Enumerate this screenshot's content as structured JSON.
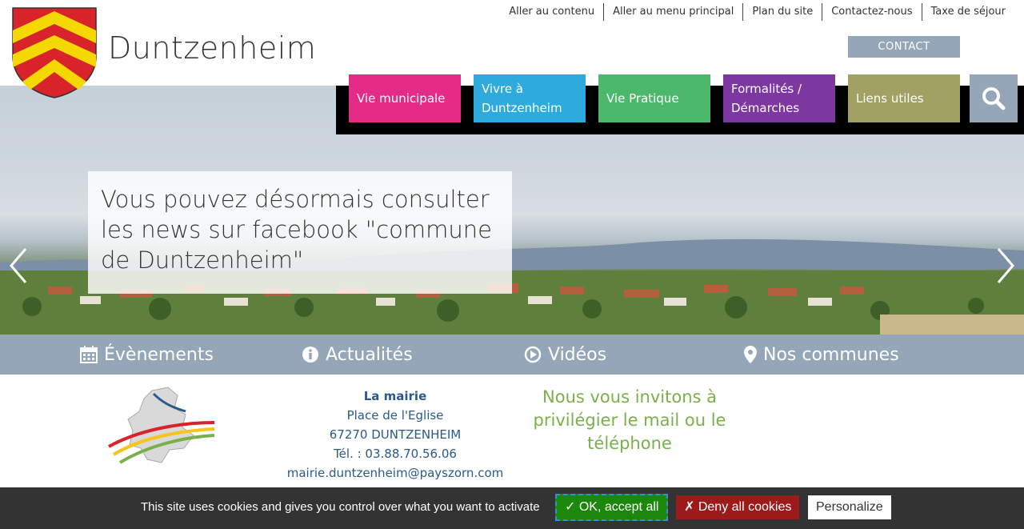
{
  "site": {
    "title": "Duntzenheim"
  },
  "top_links": [
    "Aller au contenu",
    "Aller au menu principal",
    "Plan du site",
    "Contactez-nous",
    "Taxe de séjour"
  ],
  "contact_label": "CONTACT",
  "nav": [
    {
      "label": "Vie municipale",
      "color": "#e42b86"
    },
    {
      "label": "Vivre à Duntzenheim",
      "color": "#2eaadc"
    },
    {
      "label": "Vie Pratique",
      "color": "#4cb86b"
    },
    {
      "label": "Formalités / Démarches",
      "color": "#7d37a0"
    },
    {
      "label": "Liens utiles",
      "color": "#a1a164"
    }
  ],
  "slide": {
    "text": "Vous pouvez désormais consulter les news sur facebook \"commune de Duntzenheim\""
  },
  "quick_links": [
    {
      "label": "Évènements",
      "icon": "calendar-icon"
    },
    {
      "label": "Actualités",
      "icon": "info-icon"
    },
    {
      "label": "Vidéos",
      "icon": "play-icon"
    },
    {
      "label": "Nos communes",
      "icon": "map-marker-icon"
    }
  ],
  "mairie": {
    "title": "La mairie",
    "address1": "Place de l'Eglise",
    "address2": "67270 DUNTZENHEIM",
    "phone": "Tél. : 03.88.70.56.06",
    "email": "mairie.duntzenheim@payszorn.com"
  },
  "invite": "Nous vous invitons à privilégier le mail ou le téléphone",
  "cookie": {
    "text": "This site uses cookies and gives you control over what you want to activate",
    "ok": "✓ OK, accept all",
    "deny": "✗ Deny all cookies",
    "personalize": "Personalize"
  },
  "colors": {
    "accent_gray": "#94a6b8",
    "info_blue": "#2a5a8c",
    "invite_green": "#7ab04a"
  }
}
